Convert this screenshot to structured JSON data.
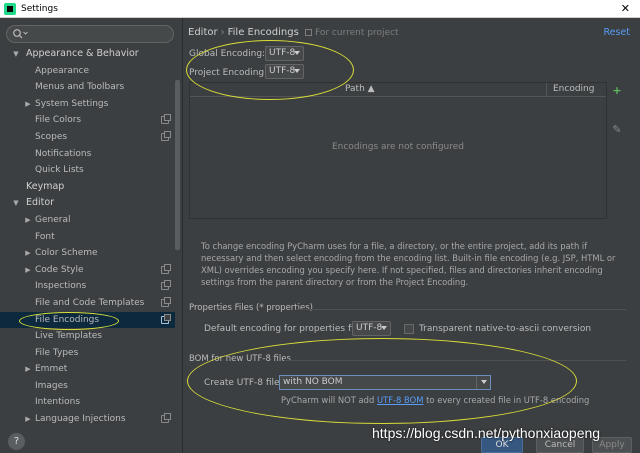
{
  "window": {
    "title": "Settings",
    "close_glyph": "✕"
  },
  "search": {
    "placeholder": "",
    "value": ""
  },
  "sidebar": {
    "items": [
      {
        "label": "Appearance & Behavior",
        "level": 0,
        "arrow": "▼",
        "top": true
      },
      {
        "label": "Appearance",
        "level": 1
      },
      {
        "label": "Menus and Toolbars",
        "level": 1
      },
      {
        "label": "System Settings",
        "level": 1,
        "arrow": "▶"
      },
      {
        "label": "File Colors",
        "level": 1,
        "proj": true
      },
      {
        "label": "Scopes",
        "level": 1,
        "proj": true
      },
      {
        "label": "Notifications",
        "level": 1
      },
      {
        "label": "Quick Lists",
        "level": 1
      },
      {
        "label": "Keymap",
        "level": 0,
        "top": true
      },
      {
        "label": "Editor",
        "level": 0,
        "arrow": "▼",
        "top": true
      },
      {
        "label": "General",
        "level": 1,
        "arrow": "▶"
      },
      {
        "label": "Font",
        "level": 1
      },
      {
        "label": "Color Scheme",
        "level": 1,
        "arrow": "▶"
      },
      {
        "label": "Code Style",
        "level": 1,
        "arrow": "▶",
        "proj": true
      },
      {
        "label": "Inspections",
        "level": 1,
        "proj": true
      },
      {
        "label": "File and Code Templates",
        "level": 1,
        "proj": true
      },
      {
        "label": "File Encodings",
        "level": 1,
        "proj": true,
        "selected": true
      },
      {
        "label": "Live Templates",
        "level": 1
      },
      {
        "label": "File Types",
        "level": 1
      },
      {
        "label": "Emmet",
        "level": 1,
        "arrow": "▶"
      },
      {
        "label": "Images",
        "level": 1
      },
      {
        "label": "Intentions",
        "level": 1
      },
      {
        "label": "Language Injections",
        "level": 1,
        "arrow": "▶",
        "proj": true
      }
    ],
    "help_glyph": "?"
  },
  "header": {
    "crumb_parent": "Editor",
    "crumb_sep": "›",
    "crumb_current": "File Encodings",
    "scope_note": "For current project",
    "reset": "Reset"
  },
  "encodings": {
    "global_label": "Global Encoding:",
    "global_value": "UTF-8",
    "project_label": "Project Encoding:",
    "project_value": "UTF-8"
  },
  "table": {
    "col_path": "Path ▲",
    "col_encoding": "Encoding",
    "empty_text": "Encodings are not configured",
    "add_glyph": "+",
    "edit_glyph": "✎"
  },
  "description": "To change encoding PyCharm uses for a file, a directory, or the entire project, add its path if necessary and then select encoding from the encoding list. Built-in file encoding (e.g. JSP, HTML or XML) overrides encoding you specify here. If not specified, files and directories inherit encoding settings from the parent directory or from the Project Encoding.",
  "properties": {
    "section_title": "Properties Files (* properties)",
    "default_label": "Default encoding for properties files:",
    "default_value": "UTF-8",
    "transparent_label": "Transparent native-to-ascii conversion",
    "transparent_checked": false
  },
  "bom": {
    "section_title": "BOM for new UTF-8 files",
    "create_label": "Create UTF-8 files:",
    "create_value": "with NO BOM",
    "note_prefix": "PyCharm will NOT add ",
    "note_link": "UTF-8 BOM",
    "note_suffix": " to every created file in UTF-8 encoding"
  },
  "buttons": {
    "ok": "OK",
    "cancel": "Cancel",
    "apply": "Apply"
  },
  "watermark": "https://blog.csdn.net/pythonxiaopeng",
  "colors": {
    "accent": "#589df6",
    "selection": "#0d293e",
    "annotation": "#d8dd38"
  }
}
